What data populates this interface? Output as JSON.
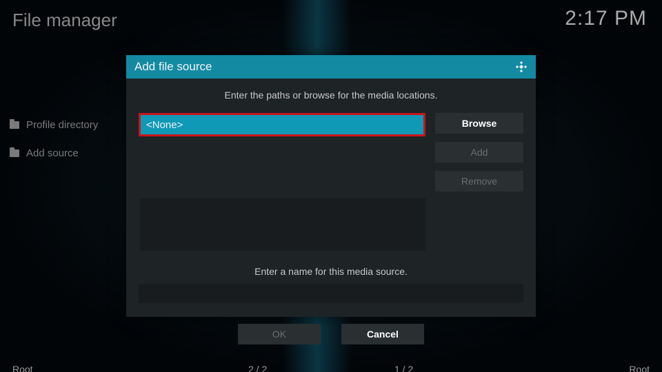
{
  "header": {
    "title": "File manager",
    "clock": "2:17 PM"
  },
  "sidebar": {
    "items": [
      {
        "label": "Profile directory"
      },
      {
        "label": "Add source"
      }
    ]
  },
  "dialog": {
    "title": "Add file source",
    "instruction": "Enter the paths or browse for the media locations.",
    "path_value": "<None>",
    "browse_label": "Browse",
    "add_label": "Add",
    "remove_label": "Remove",
    "name_instruction": "Enter a name for this media source.",
    "name_value": "",
    "ok_label": "OK",
    "cancel_label": "Cancel"
  },
  "footer": {
    "left_label": "Root",
    "left_count": "2 / 2",
    "right_count": "1 / 2",
    "right_label": "Root"
  },
  "colors": {
    "accent": "#148aa2",
    "highlight_border": "#c8151c"
  }
}
